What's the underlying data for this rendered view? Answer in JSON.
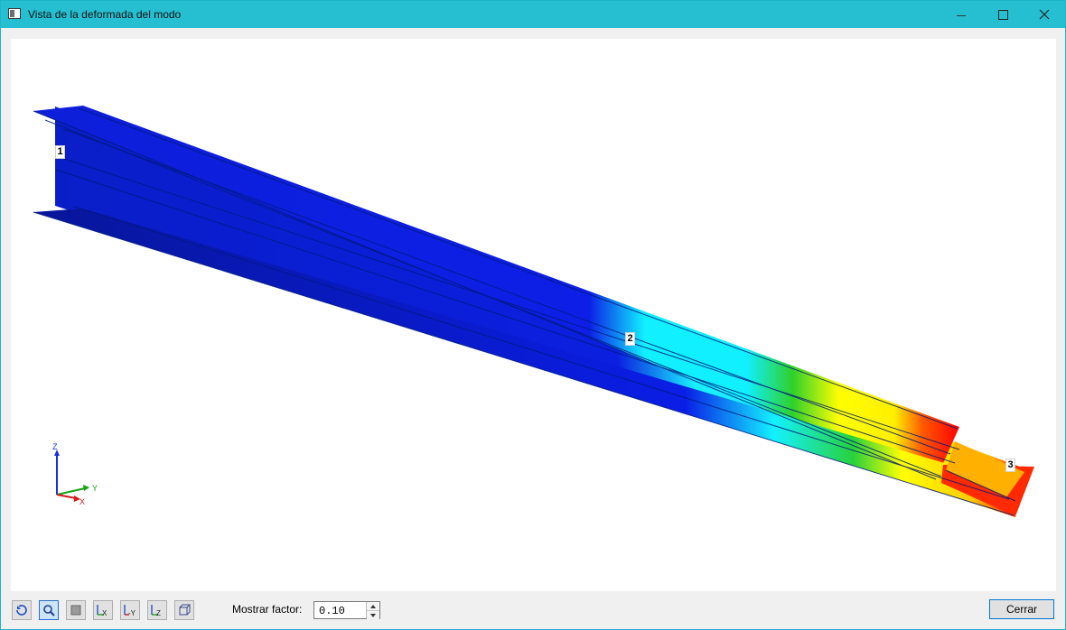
{
  "window": {
    "title": "Vista de la deformada del modo",
    "icon": "window-icon",
    "controls": {
      "minimize_icon": "minimize-icon",
      "maximize_icon": "maximize-icon",
      "close_icon": "close-icon"
    }
  },
  "viewport": {
    "nodes": [
      {
        "label": "1"
      },
      {
        "label": "2"
      },
      {
        "label": "3"
      }
    ],
    "axes": {
      "z": "Z",
      "y": "Y",
      "x": "X"
    },
    "colors": {
      "blue": "#0a1fe8",
      "cyan": "#10f0ff",
      "green": "#21cc21",
      "yellow": "#ffff00",
      "red": "#ff0000"
    }
  },
  "toolbar": {
    "buttons": [
      {
        "icon": "rotate-view-icon"
      },
      {
        "icon": "zoom-icon",
        "active": true
      },
      {
        "icon": "fill-view-icon"
      },
      {
        "icon": "view-x-icon",
        "label": "X"
      },
      {
        "icon": "view-minus-y-icon",
        "label": "-Y"
      },
      {
        "icon": "view-z-icon",
        "label": "Z"
      },
      {
        "icon": "isometric-view-icon"
      }
    ],
    "factor_label": "Mostrar factor:",
    "factor_value": "0.10",
    "close_label": "Cerrar"
  }
}
